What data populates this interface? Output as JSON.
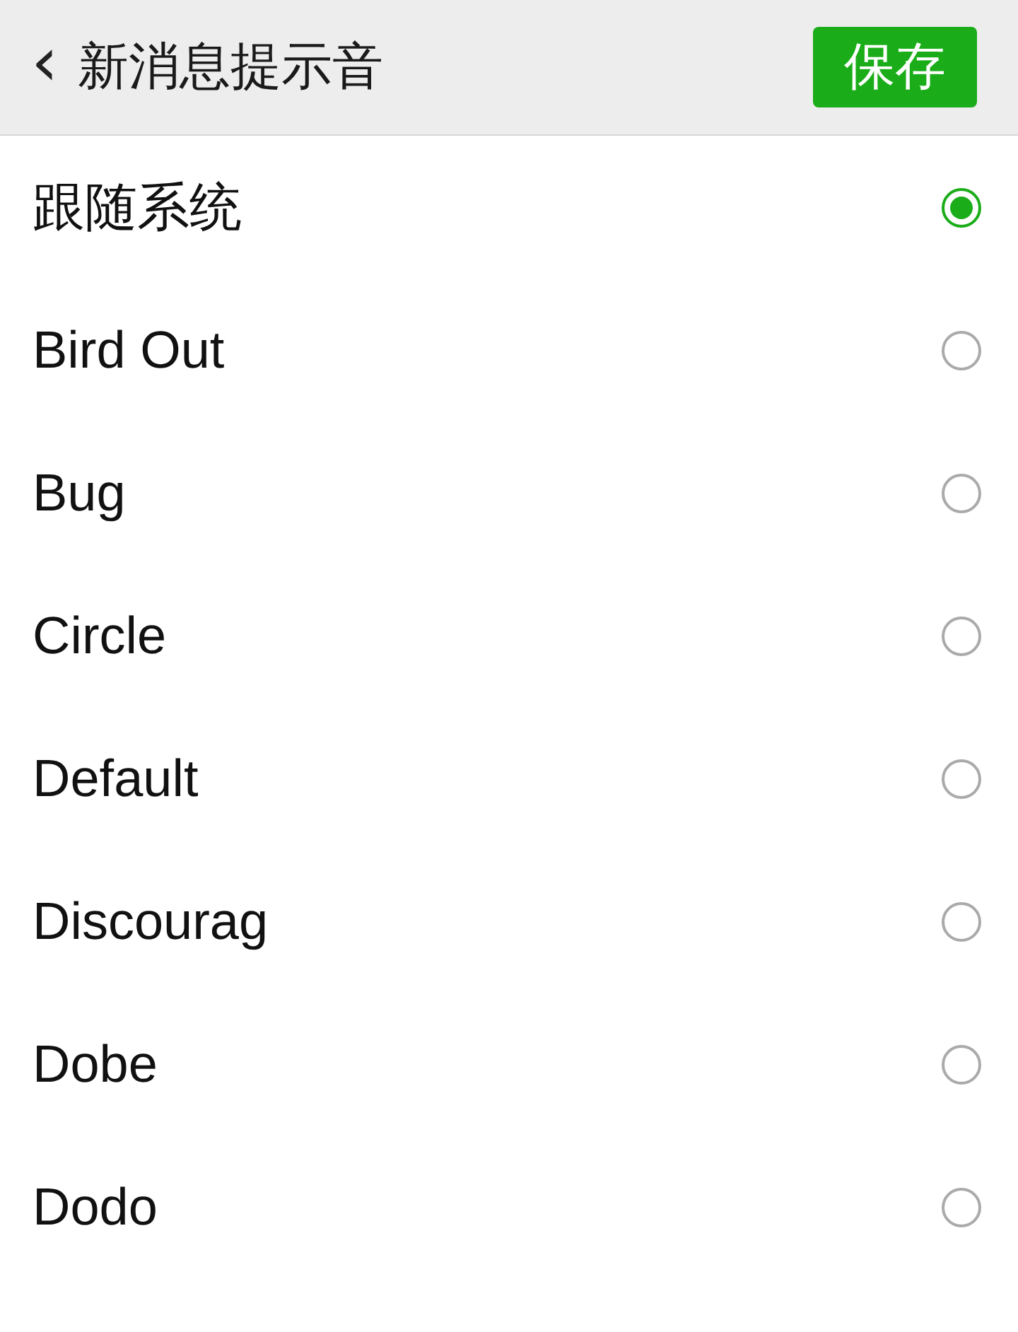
{
  "header": {
    "back": "‹",
    "title": "新消息提示音",
    "save_button": "保存"
  },
  "options": [
    {
      "label": "跟随系统",
      "selected": true
    },
    {
      "label": "Bird Out",
      "selected": false
    },
    {
      "label": "Bug",
      "selected": false
    },
    {
      "label": "Circle",
      "selected": false
    },
    {
      "label": "Default",
      "selected": false
    },
    {
      "label": "Discourag",
      "selected": false
    },
    {
      "label": "Dobe",
      "selected": false
    },
    {
      "label": "Dodo",
      "selected": false
    }
  ]
}
